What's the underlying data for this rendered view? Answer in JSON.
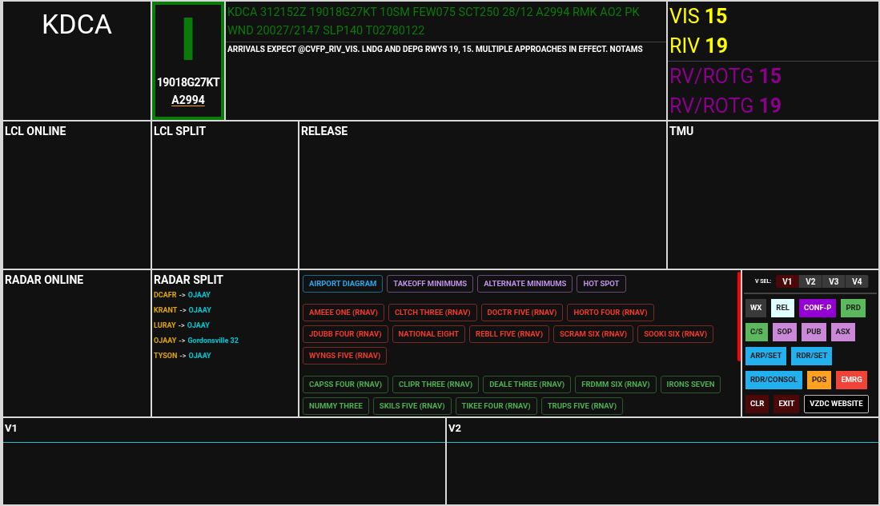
{
  "airport": "KDCA",
  "atis": {
    "letter": "I",
    "wind": "19018G27KT",
    "altimeter": "A2994"
  },
  "metar": "KDCA 312152Z 19018G27KT 10SM FEW075 SCT250 28/12 A2994 RMK AO2 PK WND 20027/2147 SLP140 T02780122",
  "remarks": "ARRIVALS EXPECT @CVFP_RIV_VIS. LNDG AND DEPG RWYS 19, 15. MULTIPLE APPROACHES IN EFFECT. NOTAMS",
  "approaches": [
    {
      "kind": "vis",
      "label": "VIS",
      "runway": "15"
    },
    {
      "kind": "vis",
      "label": "RIV",
      "runway": "19"
    }
  ],
  "departures": [
    {
      "kind": "rv",
      "label": "RV/ROTG",
      "runway": "15"
    },
    {
      "kind": "rv",
      "label": "RV/ROTG",
      "runway": "19"
    }
  ],
  "panels": {
    "lcl_online": "LCL ONLINE",
    "lcl_split": "LCL SPLIT",
    "release": "RELEASE",
    "tmu": "TMU",
    "radar_online": "RADAR ONLINE",
    "radar_split": "RADAR SPLIT"
  },
  "radar_split": [
    {
      "from": "DCAFR",
      "arrow": "->",
      "to": "OJAAY"
    },
    {
      "from": "KRANT",
      "arrow": "->",
      "to": "OJAAY"
    },
    {
      "from": "LURAY",
      "arrow": "->",
      "to": "OJAAY"
    },
    {
      "from": "OJAAY",
      "arrow": "->",
      "to": "Gordonsville 32"
    },
    {
      "from": "TYSON",
      "arrow": "->",
      "to": "OJAAY"
    }
  ],
  "chart_groups": [
    {
      "items": [
        {
          "kind": "diagram",
          "label": "AIRPORT DIAGRAM"
        },
        {
          "kind": "minimums",
          "label": "TAKEOFF MINIMUMS"
        },
        {
          "kind": "minimums",
          "label": "ALTERNATE MINIMUMS"
        },
        {
          "kind": "minimums",
          "label": "HOT SPOT"
        }
      ]
    },
    {
      "kind": "departure",
      "items": [
        {
          "label": "AMEEE ONE (RNAV)"
        },
        {
          "label": "CLTCH THREE (RNAV)"
        },
        {
          "label": "DOCTR FIVE (RNAV)"
        },
        {
          "label": "HORTO FOUR (RNAV)"
        },
        {
          "label": "JDUBB FOUR (RNAV)"
        },
        {
          "label": "NATIONAL EIGHT"
        },
        {
          "label": "REBLL FIVE (RNAV)"
        },
        {
          "label": "SCRAM SIX (RNAV)"
        },
        {
          "label": "SOOKI SIX (RNAV)"
        },
        {
          "label": "WYNGS FIVE (RNAV)"
        }
      ]
    },
    {
      "kind": "arrival",
      "items": [
        {
          "label": "CAPSS FOUR (RNAV)"
        },
        {
          "label": "CLIPR THREE (RNAV)"
        },
        {
          "label": "DEALE THREE (RNAV)"
        },
        {
          "label": "FRDMM SIX (RNAV)"
        },
        {
          "label": "IRONS SEVEN"
        },
        {
          "label": "NUMMY THREE"
        },
        {
          "label": "SKILS FIVE (RNAV)"
        },
        {
          "label": "TIKEE FOUR (RNAV)"
        },
        {
          "label": "TRUPS FIVE (RNAV)"
        }
      ]
    }
  ],
  "view_select": {
    "label": "V SEL:",
    "tabs": [
      {
        "label": "V1",
        "selected": true
      },
      {
        "label": "V2",
        "selected": false
      },
      {
        "label": "V3",
        "selected": false
      },
      {
        "label": "V4",
        "selected": false
      }
    ]
  },
  "controls": [
    [
      {
        "label": "WX",
        "color": "#3a3a3a"
      },
      {
        "label": "REL",
        "color": "#e0ffff"
      },
      {
        "label": "CONF-P",
        "color": "#9400d3"
      },
      {
        "label": "PRD",
        "color": "#5cb85c"
      }
    ],
    [
      {
        "label": "C/S",
        "color": "#5cb85c"
      },
      {
        "label": "SOP",
        "color": "#cc88d8"
      },
      {
        "label": "PUB",
        "color": "#cc88d8"
      },
      {
        "label": "ASX",
        "color": "#cc88d8"
      }
    ],
    [
      {
        "label": "ARP/SET",
        "color": "#22b0ee"
      },
      {
        "label": "RDR/SET",
        "color": "#22b0ee"
      }
    ],
    [
      {
        "label": "RDR/CONSOL",
        "color": "#22b0ee"
      },
      {
        "label": "POS",
        "color": "#ffa020"
      },
      {
        "label": "EMRG",
        "color": "#f04438"
      }
    ],
    [
      {
        "label": "CLR",
        "color": "#4a0808"
      },
      {
        "label": "EXIT",
        "color": "#4a0808"
      },
      {
        "label": "VZDC WEBSITE",
        "color": "#000000",
        "kind": "outline"
      }
    ]
  ],
  "views": [
    {
      "title": "V1"
    },
    {
      "title": "V2"
    }
  ]
}
